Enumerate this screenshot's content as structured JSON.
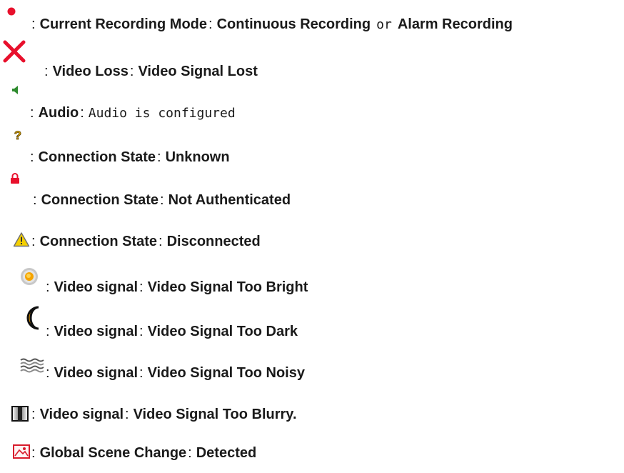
{
  "legend": {
    "separator": ":",
    "items": [
      {
        "icon": "record-dot-icon",
        "label": "Current Recording Mode",
        "value": "Continuous Recording",
        "connector": "or",
        "value2": "Alarm Recording"
      },
      {
        "icon": "video-loss-x-icon",
        "label": "Video Loss",
        "value": "Video Signal Lost"
      },
      {
        "icon": "speaker-icon",
        "label": "Audio",
        "value": "Audio is configured"
      },
      {
        "icon": "question-mark-icon",
        "label": "Connection State",
        "value": "Unknown"
      },
      {
        "icon": "lock-icon",
        "label": "Connection State",
        "value": "Not Authenticated"
      },
      {
        "icon": "warning-triangle-icon",
        "label": "Connection State",
        "value": "Disconnected"
      },
      {
        "icon": "sun-icon",
        "label": "Video signal",
        "value": "Video Signal Too Bright"
      },
      {
        "icon": "moon-icon",
        "label": "Video signal",
        "value": "Video Signal Too Dark"
      },
      {
        "icon": "noise-waves-icon",
        "label": "Video signal",
        "value": "Video Signal Too Noisy"
      },
      {
        "icon": "blur-square-icon",
        "label": "Video signal",
        "value": "Video Signal Too Blurry."
      },
      {
        "icon": "scene-change-icon",
        "label": "Global Scene Change",
        "value": "Detected"
      }
    ]
  }
}
